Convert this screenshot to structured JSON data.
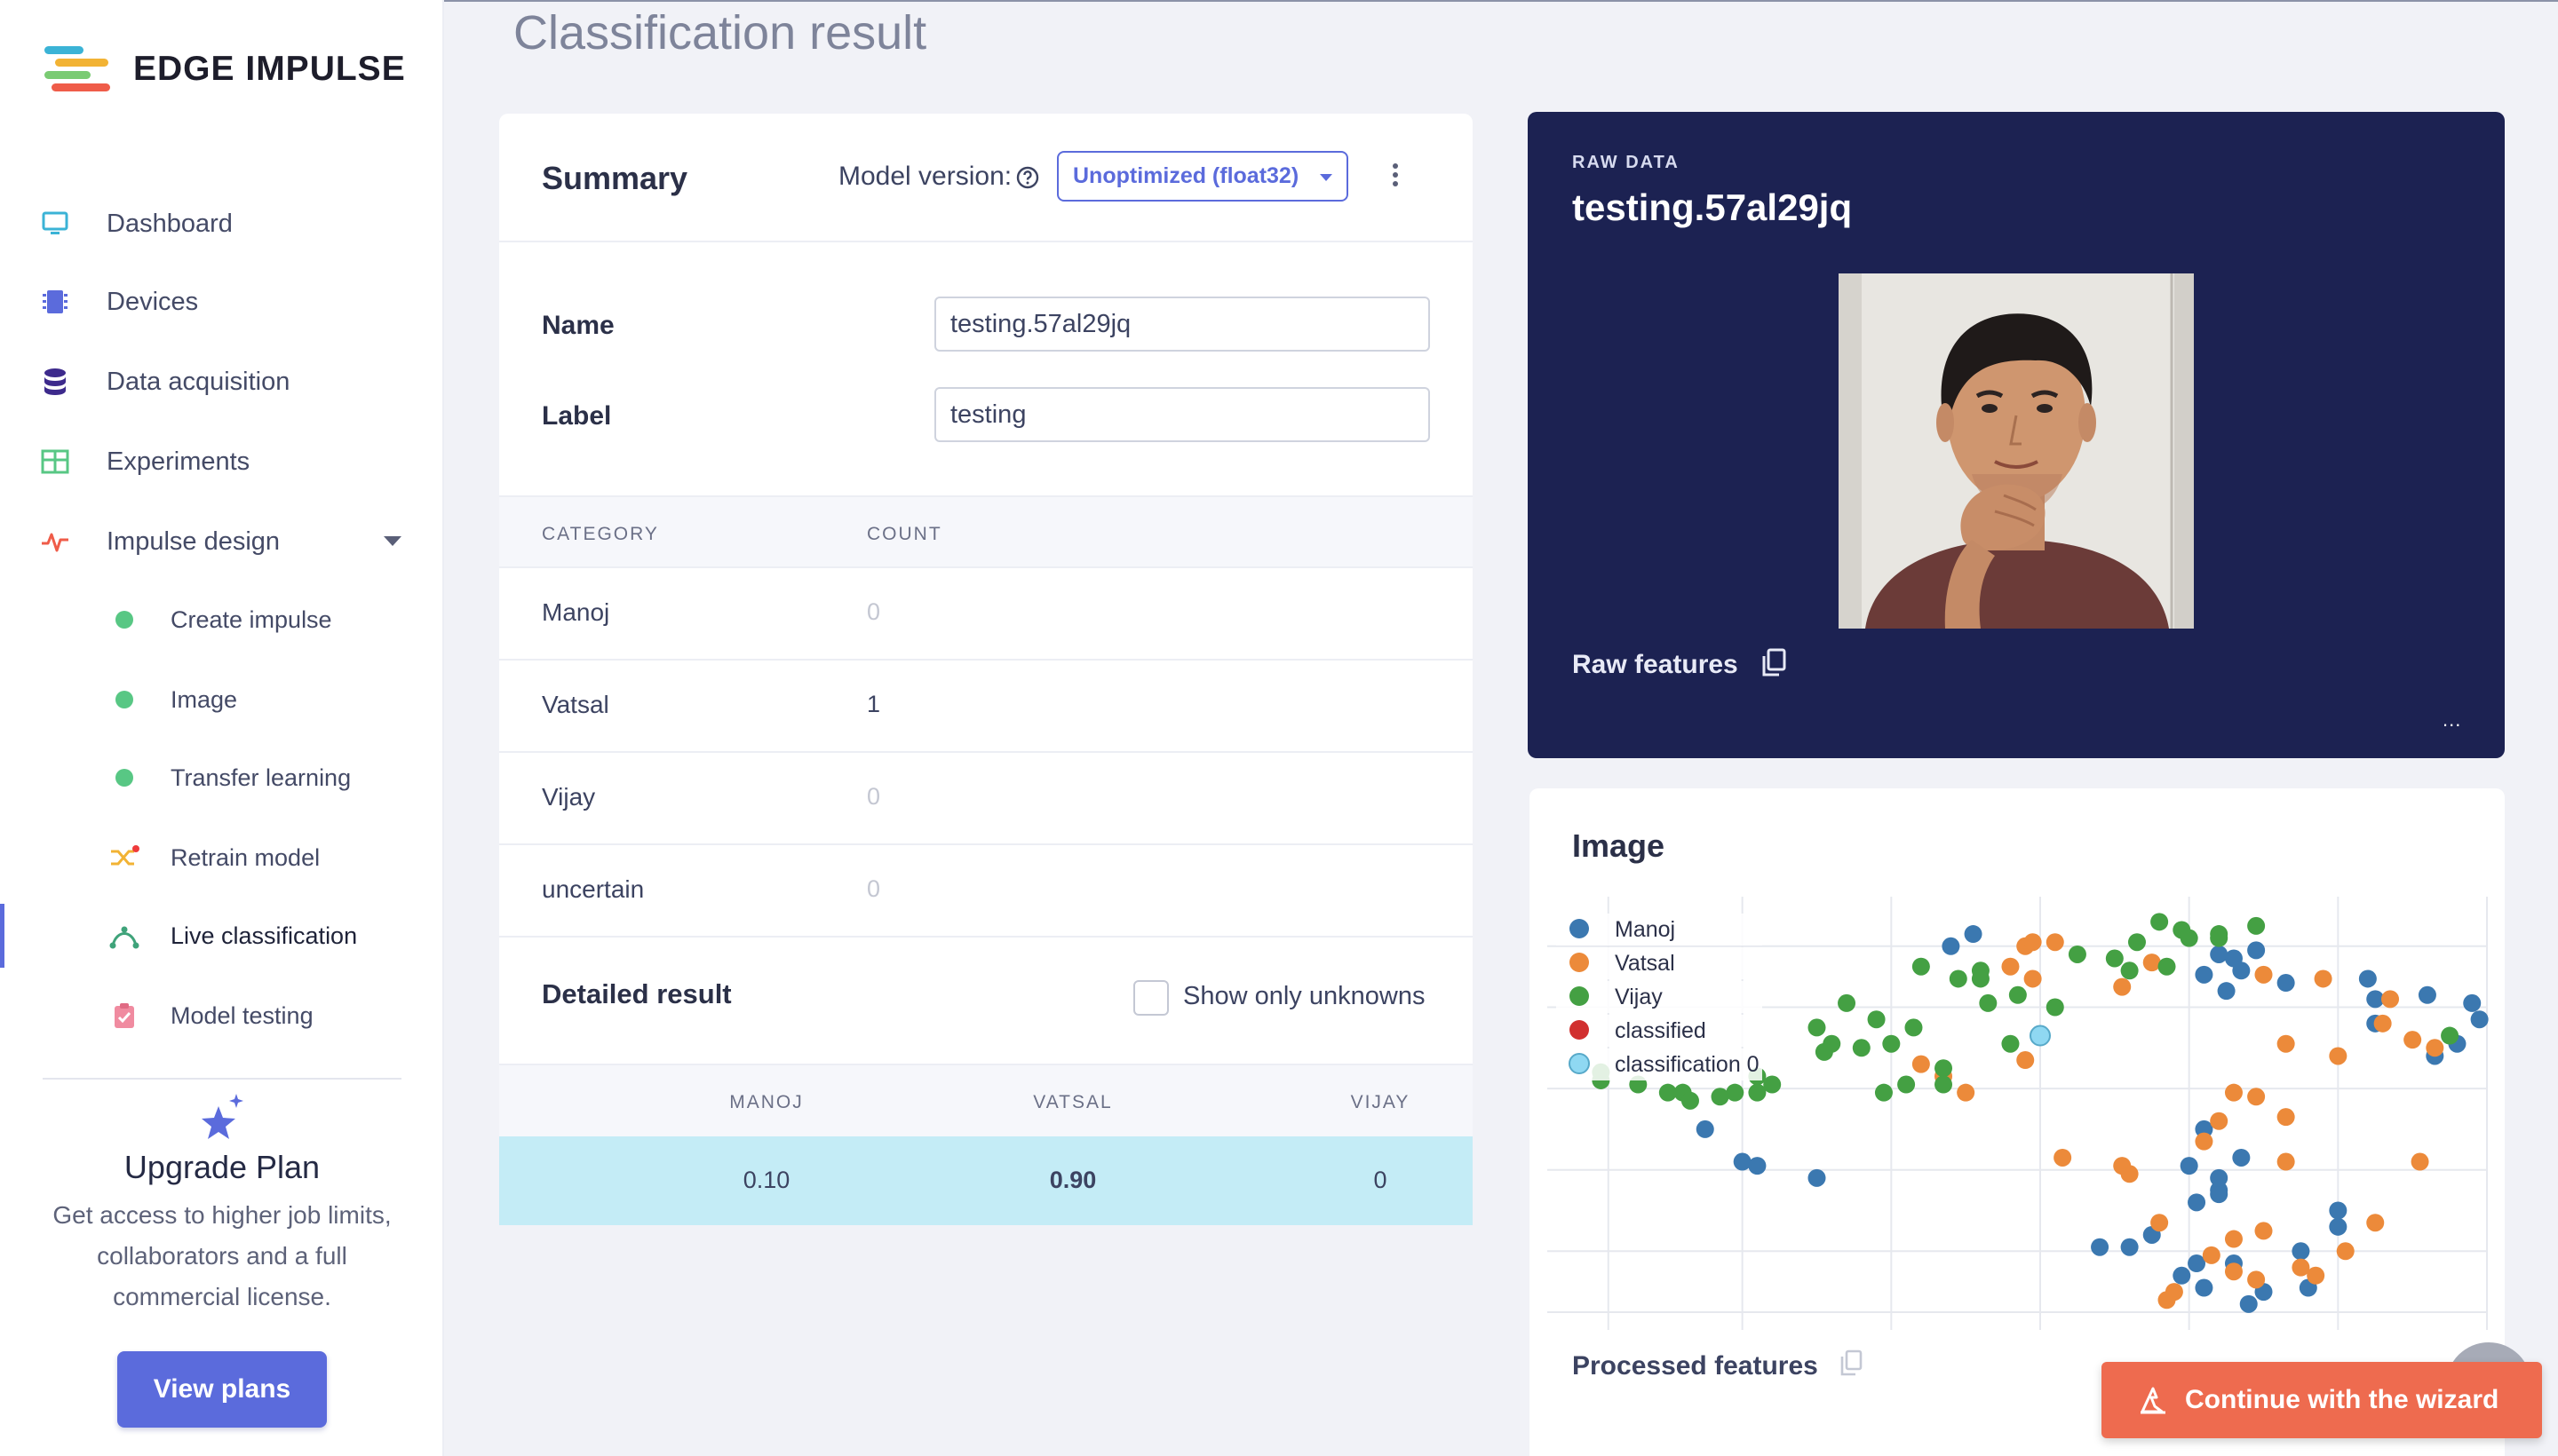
{
  "app": {
    "brand": "EDGE IMPULSE"
  },
  "sidebar": {
    "items": [
      {
        "label": "Dashboard",
        "icon": "monitor-icon"
      },
      {
        "label": "Devices",
        "icon": "chip-icon"
      },
      {
        "label": "Data acquisition",
        "icon": "database-icon"
      },
      {
        "label": "Experiments",
        "icon": "table-grid-icon"
      },
      {
        "label": "Impulse design",
        "icon": "pulse-icon"
      }
    ],
    "subitems": [
      {
        "label": "Create impulse",
        "icon": "status-dot-icon"
      },
      {
        "label": "Image",
        "icon": "status-dot-icon"
      },
      {
        "label": "Transfer learning",
        "icon": "status-dot-icon"
      },
      {
        "label": "Retrain model",
        "icon": "shuffle-icon"
      },
      {
        "label": "Live classification",
        "icon": "classification-icon"
      },
      {
        "label": "Model testing",
        "icon": "clipboard-check-icon"
      }
    ],
    "upgrade": {
      "title": "Upgrade Plan",
      "text": "Get access to higher job limits, collaborators and a full commercial license.",
      "button": "View plans"
    }
  },
  "page": {
    "title": "Classification result"
  },
  "summary": {
    "title": "Summary",
    "model_version_label": "Model version:",
    "model_version_value": "Unoptimized (float32)",
    "name_label": "Name",
    "name_value": "testing.57al29jq",
    "label_label": "Label",
    "label_value": "testing",
    "columns": [
      "CATEGORY",
      "COUNT"
    ],
    "rows": [
      {
        "category": "Manoj",
        "count": "0"
      },
      {
        "category": "Vatsal",
        "count": "1"
      },
      {
        "category": "Vijay",
        "count": "0"
      },
      {
        "category": "uncertain",
        "count": "0"
      }
    ],
    "detailed_title": "Detailed result",
    "show_unknowns_label": "Show only unknowns",
    "detailed_columns": [
      "MANOJ",
      "VATSAL",
      "VIJAY"
    ],
    "detailed_values": [
      "0.10",
      "0.90",
      "0"
    ]
  },
  "raw_data": {
    "label": "RAW DATA",
    "title": "testing.57al29jq",
    "features_label": "Raw features",
    "ellipsis": "..."
  },
  "feature_plot": {
    "title": "Image",
    "processed_label": "Processed features",
    "legend": [
      {
        "name": "Manoj",
        "color": "#3b78b0"
      },
      {
        "name": "Vatsal",
        "color": "#ec8a3a"
      },
      {
        "name": "Vijay",
        "color": "#44a043"
      },
      {
        "name": "classified",
        "color": "#d1302f"
      },
      {
        "name": "classification 0",
        "color": "#8fd8f2"
      }
    ]
  },
  "chart_data": {
    "type": "scatter",
    "title": "Image",
    "series": [
      {
        "name": "Manoj",
        "points": [
          [
            0.48,
            0.9
          ],
          [
            0.51,
            0.93
          ],
          [
            0.86,
            0.87
          ],
          [
            0.84,
            0.88
          ],
          [
            0.89,
            0.89
          ],
          [
            0.82,
            0.83
          ],
          [
            0.85,
            0.79
          ],
          [
            0.87,
            0.84
          ],
          [
            0.93,
            0.81
          ],
          [
            1.04,
            0.82
          ],
          [
            1.05,
            0.77
          ],
          [
            1.05,
            0.71
          ],
          [
            1.12,
            0.78
          ],
          [
            1.18,
            0.76
          ],
          [
            1.19,
            0.72
          ],
          [
            1.16,
            0.66
          ],
          [
            1.13,
            0.63
          ],
          [
            0.15,
            0.45
          ],
          [
            0.2,
            0.37
          ],
          [
            0.22,
            0.36
          ],
          [
            0.3,
            0.33
          ],
          [
            0.82,
            0.45
          ],
          [
            0.8,
            0.36
          ],
          [
            0.87,
            0.38
          ],
          [
            0.84,
            0.29
          ],
          [
            0.81,
            0.27
          ],
          [
            0.75,
            0.19
          ],
          [
            0.72,
            0.16
          ],
          [
            0.68,
            0.16
          ],
          [
            0.81,
            0.12
          ],
          [
            0.79,
            0.09
          ],
          [
            0.86,
            0.12
          ],
          [
            0.9,
            0.05
          ],
          [
            0.96,
            0.06
          ],
          [
            0.95,
            0.15
          ],
          [
            1.0,
            0.21
          ],
          [
            1.0,
            0.25
          ],
          [
            0.82,
            0.06
          ],
          [
            0.88,
            0.02
          ],
          [
            0.84,
            0.3
          ],
          [
            0.84,
            0.33
          ]
        ]
      },
      {
        "name": "Vatsal",
        "points": [
          [
            0.58,
            0.9
          ],
          [
            0.59,
            0.91
          ],
          [
            0.62,
            0.91
          ],
          [
            0.56,
            0.85
          ],
          [
            0.59,
            0.82
          ],
          [
            0.75,
            0.86
          ],
          [
            0.9,
            0.83
          ],
          [
            0.98,
            0.82
          ],
          [
            1.07,
            0.77
          ],
          [
            1.06,
            0.71
          ],
          [
            1.13,
            0.65
          ],
          [
            0.44,
            0.61
          ],
          [
            0.47,
            0.58
          ],
          [
            0.5,
            0.54
          ],
          [
            0.93,
            0.66
          ],
          [
            1.0,
            0.63
          ],
          [
            1.1,
            0.67
          ],
          [
            0.93,
            0.48
          ],
          [
            0.84,
            0.47
          ],
          [
            0.82,
            0.42
          ],
          [
            0.89,
            0.53
          ],
          [
            0.63,
            0.38
          ],
          [
            0.71,
            0.36
          ],
          [
            0.72,
            0.34
          ],
          [
            0.93,
            0.37
          ],
          [
            0.86,
            0.54
          ],
          [
            0.76,
            0.22
          ],
          [
            0.86,
            0.18
          ],
          [
            0.83,
            0.14
          ],
          [
            0.86,
            0.1
          ],
          [
            0.78,
            0.05
          ],
          [
            0.77,
            0.03
          ],
          [
            0.89,
            0.08
          ],
          [
            0.95,
            0.11
          ],
          [
            0.97,
            0.09
          ],
          [
            1.01,
            0.15
          ],
          [
            1.05,
            0.22
          ],
          [
            1.11,
            0.37
          ],
          [
            0.9,
            0.2
          ],
          [
            0.58,
            0.62
          ],
          [
            0.71,
            0.8
          ]
        ]
      },
      {
        "name": "Vijay",
        "points": [
          [
            0.76,
            0.96
          ],
          [
            0.8,
            0.92
          ],
          [
            0.77,
            0.85
          ],
          [
            0.73,
            0.91
          ],
          [
            0.7,
            0.87
          ],
          [
            0.44,
            0.85
          ],
          [
            0.52,
            0.84
          ],
          [
            0.52,
            0.82
          ],
          [
            0.57,
            0.78
          ],
          [
            0.53,
            0.76
          ],
          [
            0.62,
            0.75
          ],
          [
            0.56,
            0.66
          ],
          [
            0.34,
            0.76
          ],
          [
            0.3,
            0.7
          ],
          [
            0.32,
            0.66
          ],
          [
            0.31,
            0.64
          ],
          [
            0.36,
            0.65
          ],
          [
            0.38,
            0.72
          ],
          [
            0.43,
            0.7
          ],
          [
            0.4,
            0.66
          ],
          [
            0.39,
            0.54
          ],
          [
            0.42,
            0.56
          ],
          [
            0.47,
            0.6
          ],
          [
            0.47,
            0.56
          ],
          [
            0.22,
            0.58
          ],
          [
            0.24,
            0.56
          ],
          [
            0.19,
            0.54
          ],
          [
            0.17,
            0.53
          ],
          [
            0.01,
            0.59
          ],
          [
            0.01,
            0.57
          ],
          [
            0.06,
            0.56
          ],
          [
            0.1,
            0.54
          ],
          [
            0.12,
            0.54
          ],
          [
            0.13,
            0.52
          ],
          [
            0.22,
            0.54
          ],
          [
            1.15,
            0.68
          ],
          [
            0.89,
            0.95
          ],
          [
            0.84,
            0.93
          ],
          [
            0.84,
            0.92
          ],
          [
            0.79,
            0.94
          ],
          [
            0.49,
            0.82
          ],
          [
            0.65,
            0.88
          ],
          [
            0.72,
            0.84
          ]
        ]
      },
      {
        "name": "classification 0",
        "points": [
          [
            0.6,
            0.68
          ]
        ]
      }
    ],
    "legend_position": "top-left",
    "grid": true
  }
}
